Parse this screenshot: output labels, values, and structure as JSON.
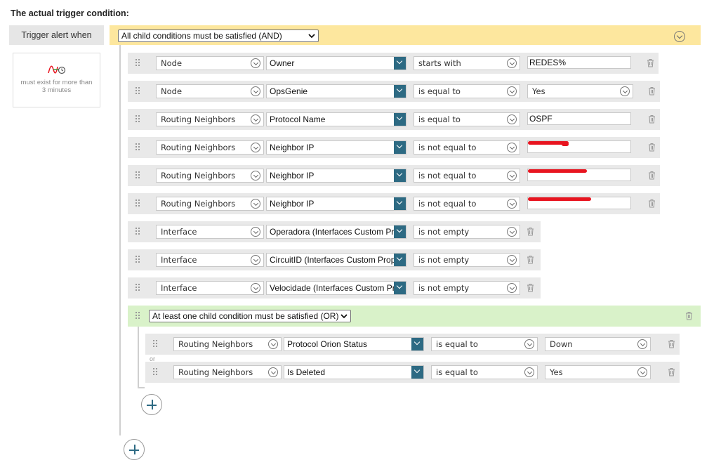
{
  "heading": "The actual trigger condition:",
  "trigger_label": "Trigger alert when",
  "duration_text": "must exist for more than 3 minutes",
  "root_group": {
    "selected": "All child conditions must be satisfied (AND)",
    "color": "#fde79e"
  },
  "conditions": [
    {
      "entity": "Node",
      "field": "Owner",
      "operator": "starts with",
      "value": "REDES%"
    },
    {
      "entity": "Node",
      "field": "OpsGenie",
      "operator": "is equal to",
      "value": "Yes"
    },
    {
      "entity": "Routing Neighbors",
      "field": "Protocol Name",
      "operator": "is equal to",
      "value": "OSPF"
    },
    {
      "entity": "Routing Neighbors",
      "field": "Neighbor IP",
      "operator": "is not equal to",
      "value": ""
    },
    {
      "entity": "Routing Neighbors",
      "field": "Neighbor IP",
      "operator": "is not equal to",
      "value": ""
    },
    {
      "entity": "Routing Neighbors",
      "field": "Neighbor IP",
      "operator": "is not equal to",
      "value": ""
    },
    {
      "entity": "Interface",
      "field": "Operadora (Interfaces Custom Properties)",
      "operator": "is not empty"
    },
    {
      "entity": "Interface",
      "field": "CircuitID (Interfaces Custom Properties)",
      "operator": "is not empty"
    },
    {
      "entity": "Interface",
      "field": "Velocidade (Interfaces Custom Properties)",
      "operator": "is not empty"
    }
  ],
  "or_group": {
    "selected": "At least one child condition must be satisfied (OR)",
    "color": "#d9f2c9",
    "separator": "or",
    "conditions": [
      {
        "entity": "Routing Neighbors",
        "field": "Protocol Orion Status",
        "operator": "is equal to",
        "value": "Down"
      },
      {
        "entity": "Routing Neighbors",
        "field": "Is Deleted",
        "operator": "is equal to",
        "value": "Yes"
      }
    ]
  },
  "colors": {
    "accent": "#2d6a83",
    "redaction": "#e8141f",
    "row_bg": "#e9e9e9"
  }
}
